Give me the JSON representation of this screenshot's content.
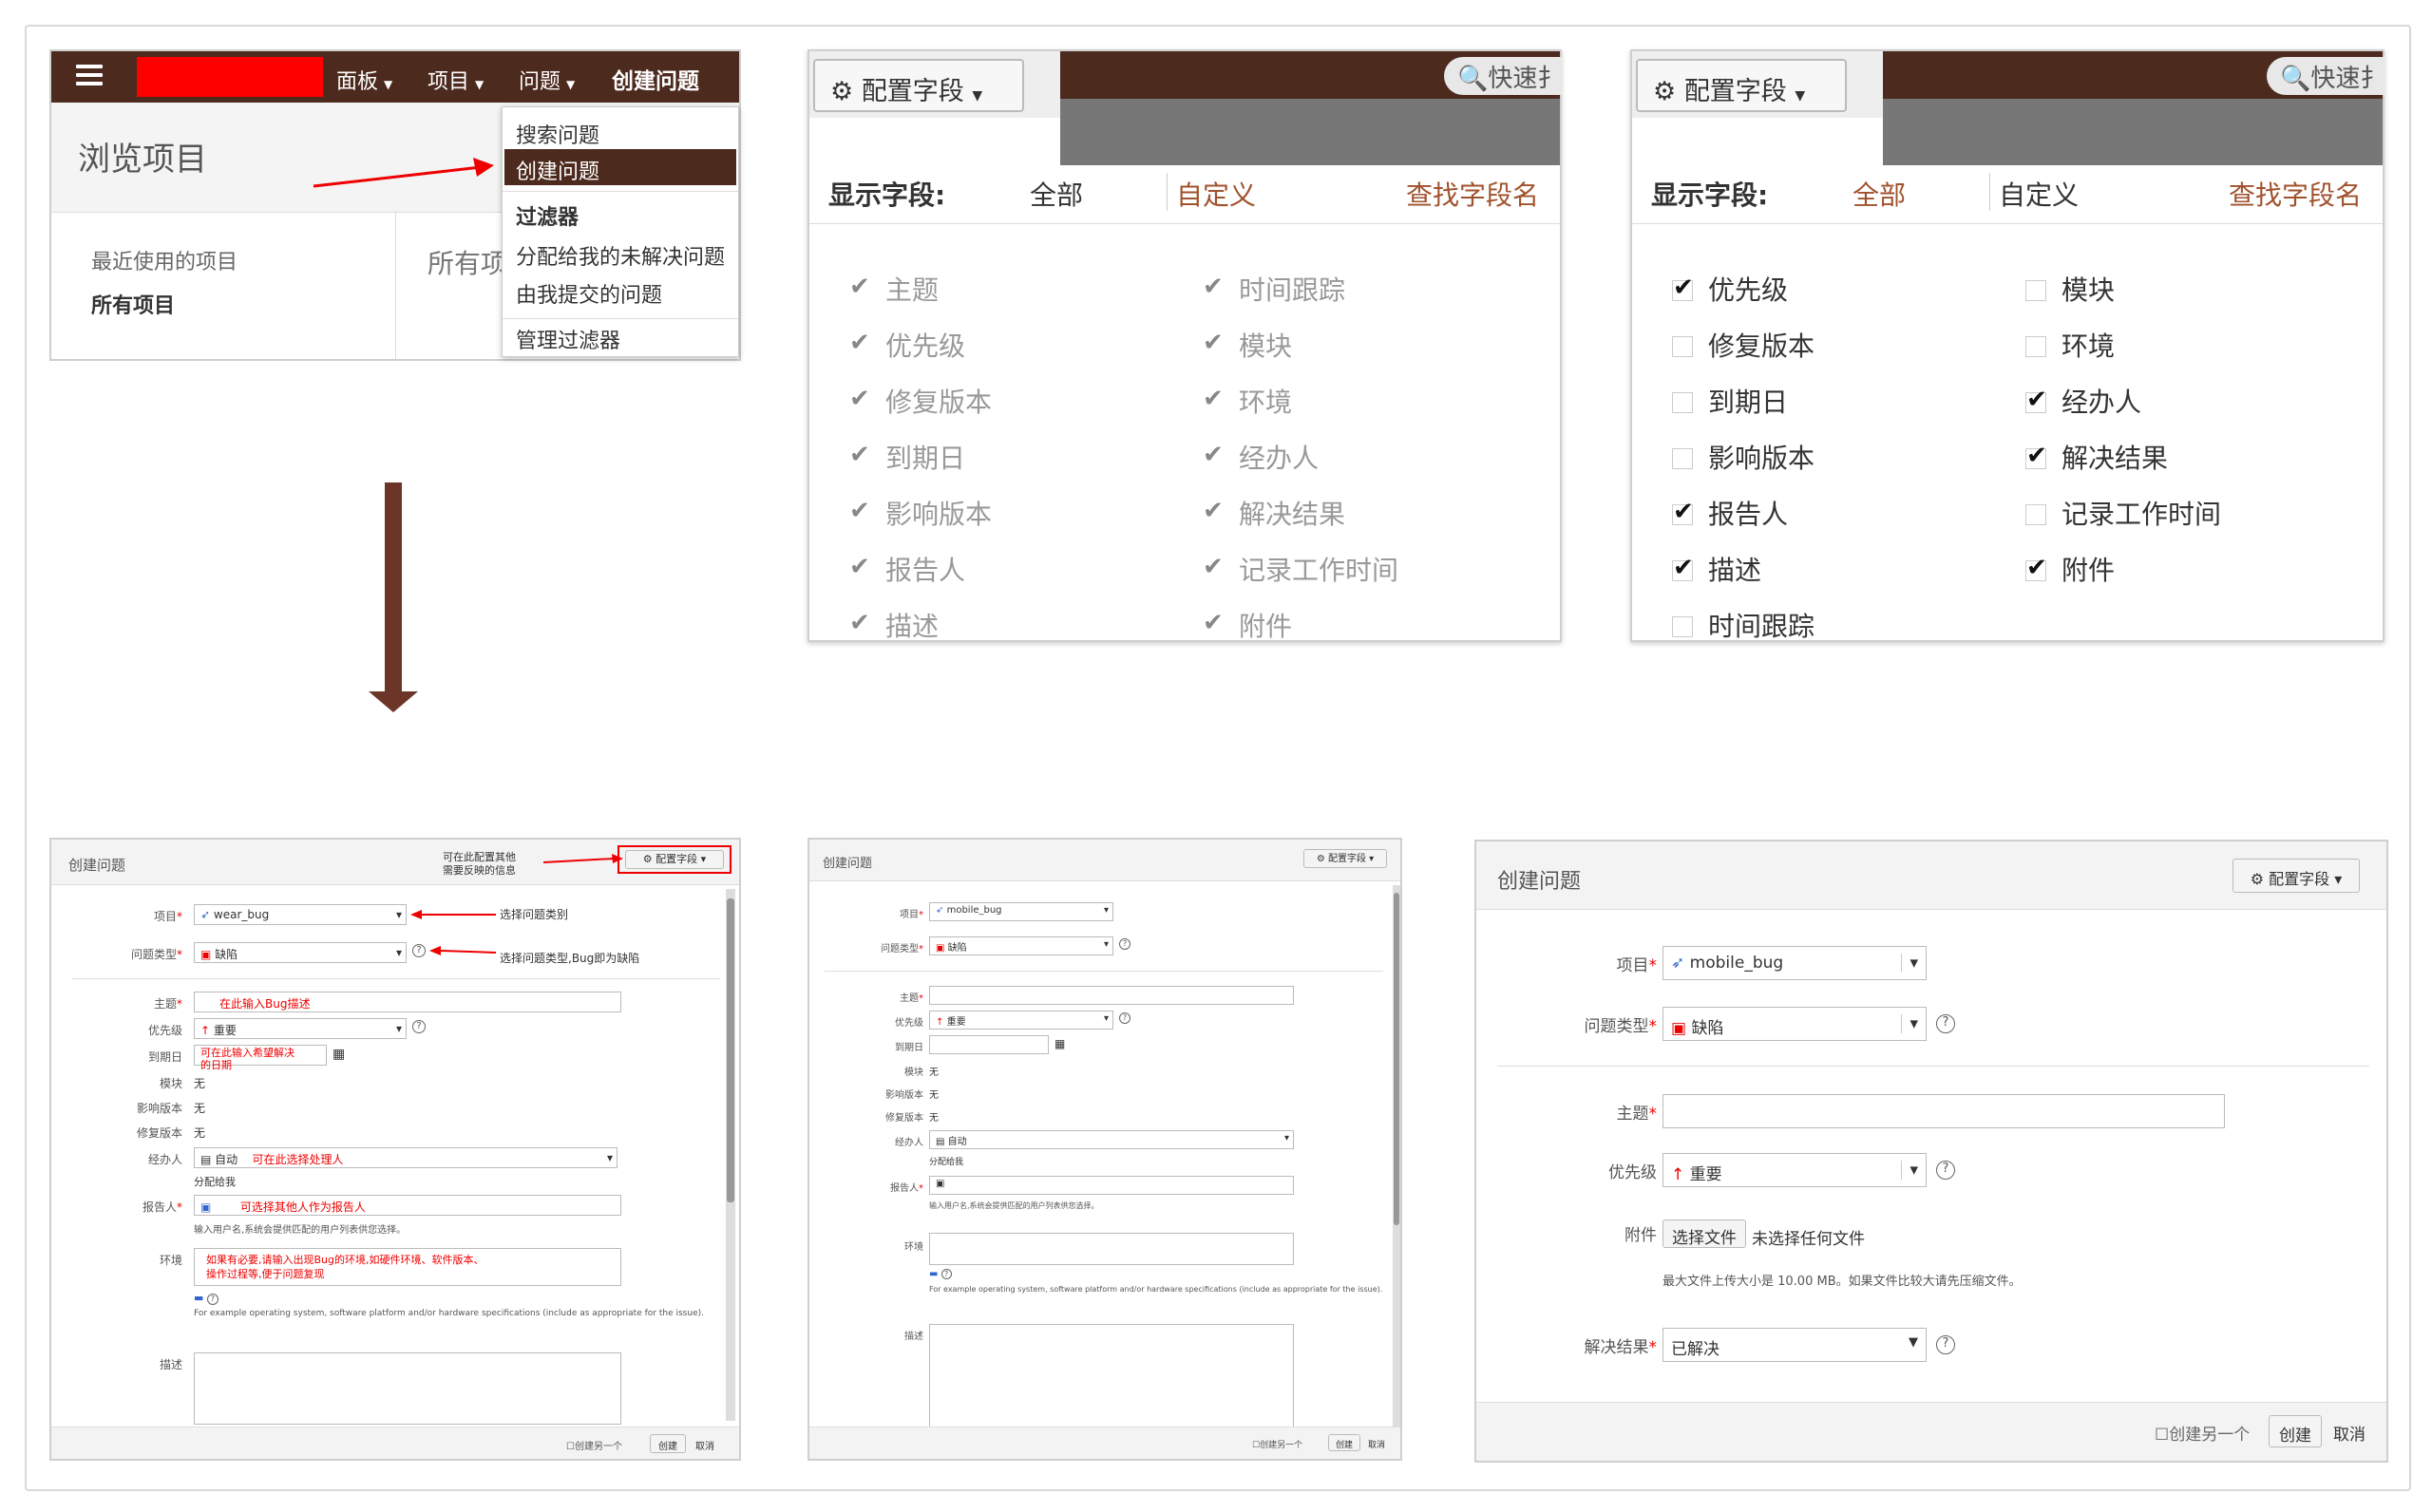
{
  "nav": {
    "board": "面板",
    "project": "项目",
    "issue": "问题",
    "create": "创建问题"
  },
  "browse": {
    "title": "浏览项目",
    "recent": "最近使用的项目",
    "all_projects": "所有项目",
    "all_cut": "所有项"
  },
  "issue_menu": {
    "search": "搜索问题",
    "create": "创建问题",
    "filters": "过滤器",
    "assigned": "分配给我的未解决问题",
    "reported": "由我提交的问题",
    "manage": "管理过滤器"
  },
  "config": {
    "button": "配置字段",
    "quick_search": "快速扌",
    "show_fields": "显示字段:",
    "all": "全部",
    "custom": "自定义",
    "find": "查找字段名",
    "all_state": {
      "left": [
        {
          "label": "主题",
          "checked": true
        },
        {
          "label": "优先级",
          "checked": true
        },
        {
          "label": "修复版本",
          "checked": true
        },
        {
          "label": "到期日",
          "checked": true
        },
        {
          "label": "影响版本",
          "checked": true
        },
        {
          "label": "报告人",
          "checked": true
        },
        {
          "label": "描述",
          "checked": true
        }
      ],
      "right": [
        {
          "label": "时间跟踪",
          "checked": true
        },
        {
          "label": "模块",
          "checked": true
        },
        {
          "label": "环境",
          "checked": true
        },
        {
          "label": "经办人",
          "checked": true
        },
        {
          "label": "解决结果",
          "checked": true
        },
        {
          "label": "记录工作时间",
          "checked": true
        },
        {
          "label": "附件",
          "checked": true
        }
      ]
    },
    "custom_state": {
      "left": [
        {
          "label": "优先级",
          "checked": true
        },
        {
          "label": "修复版本",
          "checked": false
        },
        {
          "label": "到期日",
          "checked": false
        },
        {
          "label": "影响版本",
          "checked": false
        },
        {
          "label": "报告人",
          "checked": true
        },
        {
          "label": "描述",
          "checked": true
        },
        {
          "label": "时间跟踪",
          "checked": false
        }
      ],
      "right": [
        {
          "label": "模块",
          "checked": false
        },
        {
          "label": "环境",
          "checked": false
        },
        {
          "label": "经办人",
          "checked": true
        },
        {
          "label": "解决结果",
          "checked": true
        },
        {
          "label": "记录工作时间",
          "checked": false
        },
        {
          "label": "附件",
          "checked": true
        }
      ]
    }
  },
  "form_common": {
    "title": "创建问题",
    "config_button": "配置字段",
    "create_another": "创建另一个",
    "create": "创建",
    "cancel": "取消",
    "project_label": "项目",
    "type_label": "问题类型",
    "type_value": "缺陷",
    "summary_label": "主题",
    "priority_label": "优先级",
    "priority_value": "重要",
    "due_label": "到期日",
    "component_label": "模块",
    "affects_label": "影响版本",
    "fix_label": "修复版本",
    "none": "无",
    "assignee_label": "经办人",
    "assignee_value": "自动",
    "assign_me": "分配给我",
    "reporter_label": "报告人",
    "reporter_hint": "输入用户名,系统会提供匹配的用户列表供您选择。",
    "env_label": "环境",
    "env_hint": "For example operating system, software platform and/or hardware specifications (include as appropriate for the issue).",
    "desc_label": "描述",
    "attach_label": "附件",
    "choose_file": "选择文件",
    "no_file": "未选择任何文件",
    "size_hint": "最大文件上传大小是 10.00 MB。如果文件比较大请先压缩文件。",
    "resolution_label": "解决结果",
    "resolution_value": "已解决"
  },
  "form1": {
    "project_value": "wear_bug",
    "notes": {
      "config": "可在此配置其他\n需要反映的信息",
      "project": "选择问题类别",
      "type": "选择问题类型,Bug即为缺陷",
      "summary": "在此输入Bug描述",
      "due": "可在此输入希望解决\n的日期",
      "assignee": "可在此选择处理人",
      "reporter": "可选择其他人作为报告人",
      "env": "如果有必要,请输入出现Bug的环境,如硬件环境、软件版本、\n操作过程等,便于问题复现"
    }
  },
  "form2": {
    "project_value": "mobile_bug"
  },
  "form3": {
    "project_value": "mobile_bug"
  }
}
